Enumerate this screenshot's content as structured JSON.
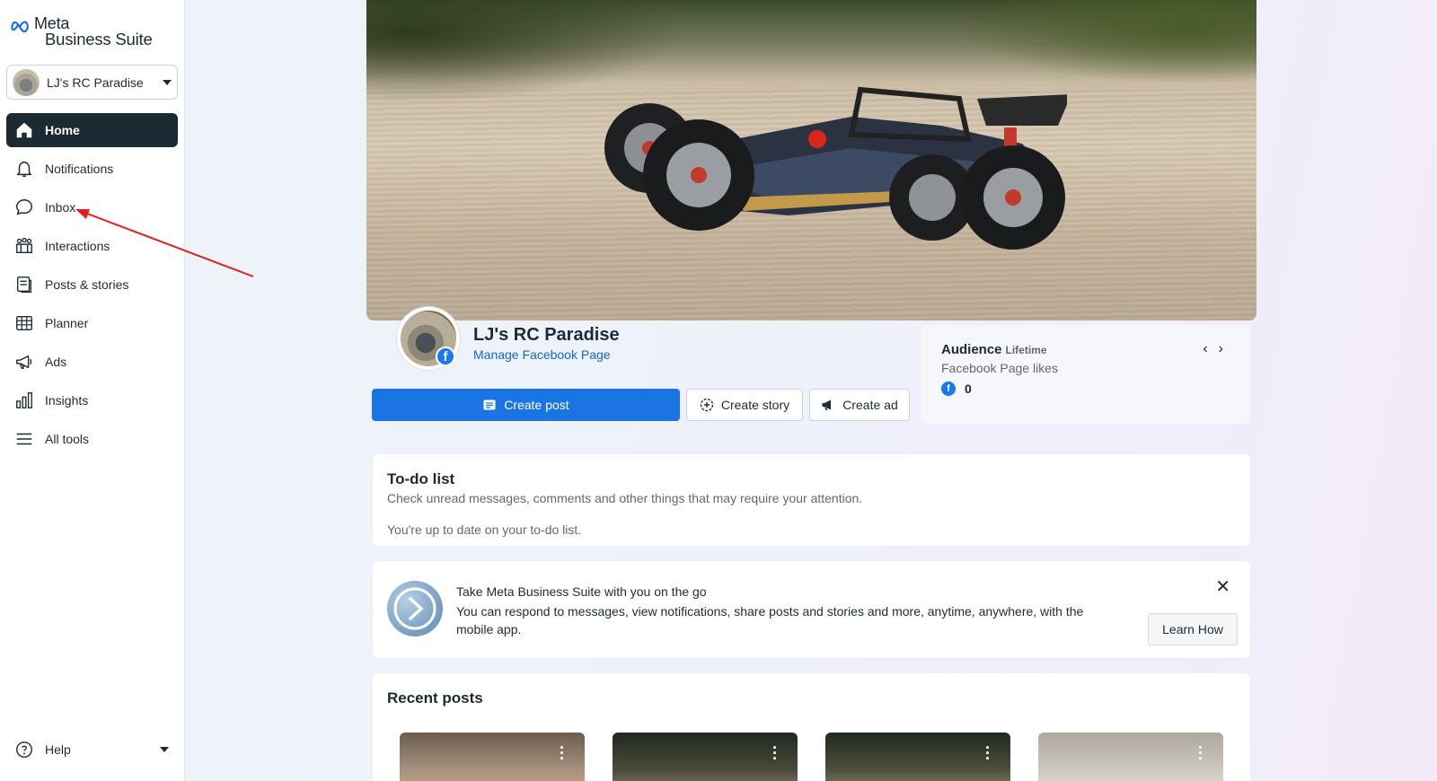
{
  "brand": {
    "line1": "Meta",
    "line2": "Business Suite"
  },
  "account": {
    "name": "LJ's RC Paradise"
  },
  "nav": [
    {
      "label": "Home",
      "icon": "home-icon",
      "active": true
    },
    {
      "label": "Notifications",
      "icon": "bell-icon"
    },
    {
      "label": "Inbox",
      "icon": "chat-bubble-icon"
    },
    {
      "label": "Interactions",
      "icon": "interactions-icon"
    },
    {
      "label": "Posts & stories",
      "icon": "posts-icon"
    },
    {
      "label": "Planner",
      "icon": "calendar-grid-icon"
    },
    {
      "label": "Ads",
      "icon": "megaphone-icon"
    },
    {
      "label": "Insights",
      "icon": "bar-chart-icon"
    },
    {
      "label": "All tools",
      "icon": "menu-icon"
    }
  ],
  "help": {
    "label": "Help"
  },
  "page": {
    "name": "LJ's RC Paradise",
    "manage_link": "Manage Facebook Page"
  },
  "actions": {
    "create_post": "Create post",
    "create_story": "Create story",
    "create_ad": "Create ad"
  },
  "audience": {
    "title": "Audience",
    "period": "Lifetime",
    "metric": "Facebook Page likes",
    "value": "0"
  },
  "todo": {
    "title": "To-do list",
    "description": "Check unread messages, comments and other things that may require your attention.",
    "status": "You're up to date on your to-do list."
  },
  "promo": {
    "title": "Take Meta Business Suite with you on the go",
    "description": "You can respond to messages, view notifications, share posts and stories and more, anytime, anywhere, with the mobile app.",
    "button": "Learn How"
  },
  "recent": {
    "title": "Recent posts"
  },
  "colors": {
    "primary": "#1b74e4",
    "sidebar_active": "#1c2b33",
    "link": "#1467c8",
    "annotation_arrow": "#e0201b"
  }
}
